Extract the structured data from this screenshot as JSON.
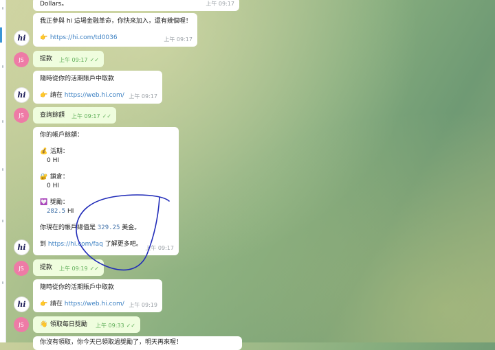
{
  "messages": [
    {
      "id": "m0",
      "dir": "in",
      "lines": [
        "Dollars。"
      ],
      "time": "上午 09:17"
    },
    {
      "id": "m1",
      "dir": "in",
      "line1": "我正參與 hi 這場金融革命，你快來加入，還有幾個喔！",
      "emoji": "👉",
      "link": "https://hi.com/td0036",
      "time": "上午 09:17"
    },
    {
      "id": "m2",
      "dir": "out",
      "text": "提款",
      "time": "上午 09:17"
    },
    {
      "id": "m3",
      "dir": "in",
      "line1": "隨時從你的活期賬戶中取款",
      "emoji": "👉",
      "prefix": "請在",
      "link": "https://web.hi.com/",
      "time": "上午 09:17"
    },
    {
      "id": "m4",
      "dir": "out",
      "text": "查詢餘額",
      "time": "上午 09:17"
    },
    {
      "id": "m5",
      "dir": "in",
      "header": "你的帳戶餘額：",
      "sections": [
        {
          "icon": "💰",
          "label": "活期：",
          "value": "0 HI"
        },
        {
          "icon": "🔐",
          "label": "鎖倉：",
          "value": "0 HI"
        },
        {
          "icon": "💟",
          "label": "獎勵：",
          "value_num": "282.5",
          "value_unit": " HI"
        }
      ],
      "total_prefix": "你現在的帳戶總值是",
      "total_value": "329.25",
      "total_suffix": "美金。",
      "faq_prefix": "到",
      "faq_link": "https://hi.com/faq",
      "faq_suffix": "了解更多吧。",
      "time": "上午 09:17"
    },
    {
      "id": "m6",
      "dir": "out",
      "text": "提款",
      "time": "上午 09:19"
    },
    {
      "id": "m7",
      "dir": "in",
      "line1": "隨時從你的活期賬戶中取款",
      "emoji": "👉",
      "prefix": "請在",
      "link": "https://web.hi.com/",
      "time": "上午 09:19"
    },
    {
      "id": "m8",
      "dir": "out",
      "emoji": "👋",
      "text": "領取每日獎勵",
      "time": "上午 09:33"
    },
    {
      "id": "m9",
      "dir": "in",
      "partial": "你沒有領取，你今天已領取過獎勵了，明天再來喔！"
    }
  ],
  "avatars": {
    "user_initials": "JS",
    "bot_glyph": "hi"
  },
  "ticks": "✓✓",
  "colors": {
    "out_bubble": "#effdde",
    "in_bubble": "#ffffff",
    "link": "#3a7fc2",
    "avatar_user": "#ee7ba6",
    "scribble": "#1f2ab8"
  }
}
